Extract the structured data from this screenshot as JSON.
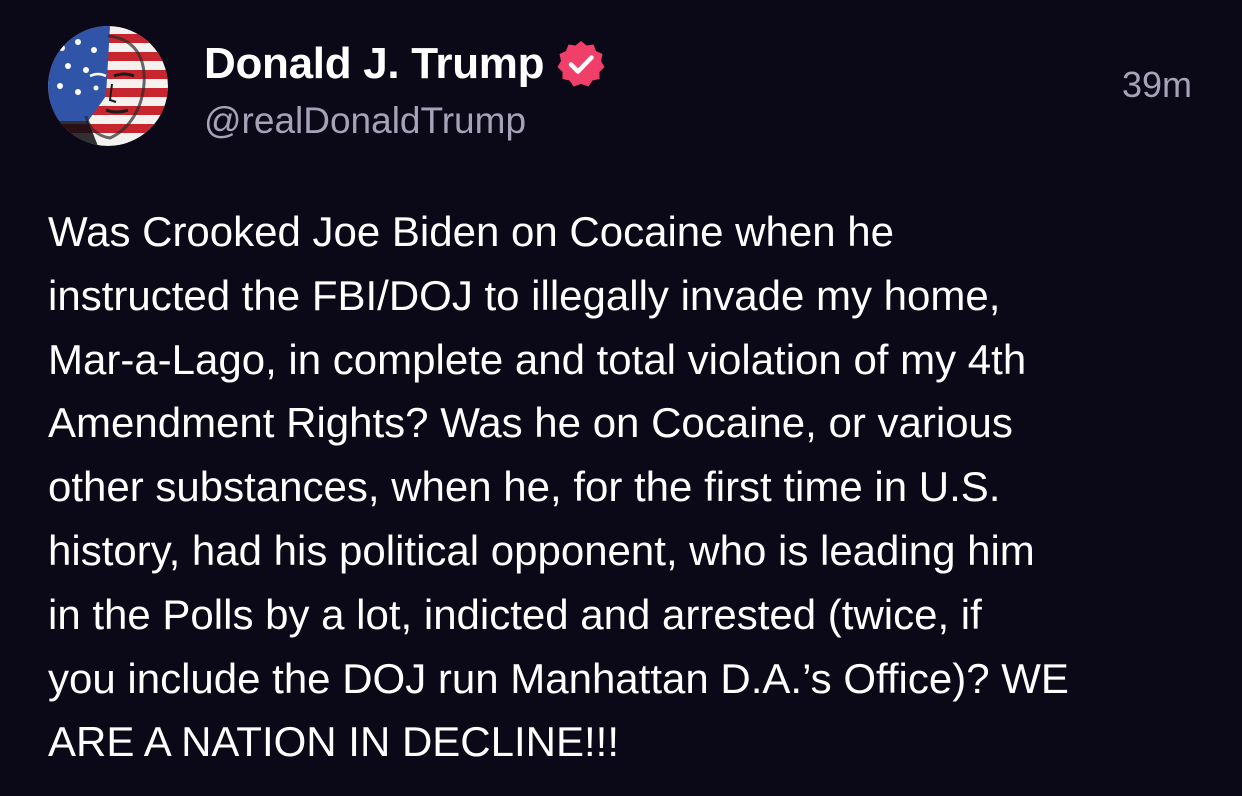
{
  "author": {
    "display_name": "Donald J. Trump",
    "handle": "@realDonaldTrump",
    "verified": true,
    "avatar_icon": "flag-painted-portrait-avatar"
  },
  "timestamp": "39m",
  "post": {
    "lines": [
      "Was Crooked Joe Biden on Cocaine when he",
      "instructed the FBI/DOJ to illegally invade my home,",
      "Mar-a-Lago, in complete and total violation of my 4th",
      "Amendment Rights? Was he on Cocaine, or various",
      "other substances, when he, for the first time in U.S.",
      "history, had his political opponent, who is leading him",
      "in the Polls by a lot, indicted and arrested (twice, if",
      "you include the DOJ run Manhattan D.A.’s Office)? WE",
      "ARE A NATION IN DECLINE!!!"
    ]
  },
  "colors": {
    "background": "#0b0817",
    "text_primary": "#ffffff",
    "text_secondary": "#a6a3b8",
    "verified_badge": "#f0406a"
  }
}
